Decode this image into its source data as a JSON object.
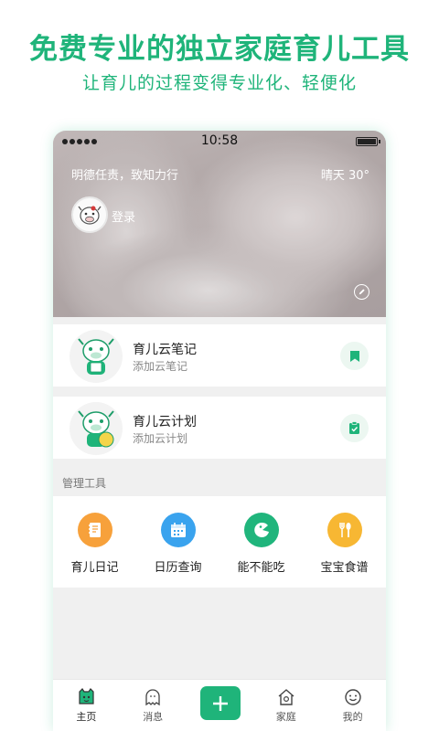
{
  "banner": {
    "headline": "免费专业的独立家庭育儿工具",
    "subline": "让育儿的过程变得专业化、轻便化"
  },
  "status_bar": {
    "time": "10:58"
  },
  "hero": {
    "motto": "明德任责，致知力行",
    "weather": "晴天  30°",
    "login_label": "登录"
  },
  "cards": [
    {
      "title": "育儿云笔记",
      "desc": "添加云笔记",
      "action_icon": "bookmark-icon"
    },
    {
      "title": "育儿云计划",
      "desc": "添加云计划",
      "action_icon": "clipboard-check-icon"
    }
  ],
  "tools_section": {
    "label": "管理工具",
    "items": [
      {
        "label": "育儿日记",
        "icon": "notebook-icon",
        "color": "#f7a13b"
      },
      {
        "label": "日历查询",
        "icon": "calendar-icon",
        "color": "#3aa3ee"
      },
      {
        "label": "能不能吃",
        "icon": "chomp-icon",
        "color": "#20b57c"
      },
      {
        "label": "宝宝食谱",
        "icon": "fork-spoon-icon",
        "color": "#f7b733"
      }
    ]
  },
  "tabbar": {
    "items": [
      {
        "label": "主页",
        "icon": "home-face-icon"
      },
      {
        "label": "消息",
        "icon": "ghost-message-icon"
      },
      {
        "label": "",
        "icon": "plus-icon"
      },
      {
        "label": "家庭",
        "icon": "house-icon"
      },
      {
        "label": "我的",
        "icon": "smiley-icon"
      }
    ]
  },
  "colors": {
    "brand": "#1fb47a"
  }
}
